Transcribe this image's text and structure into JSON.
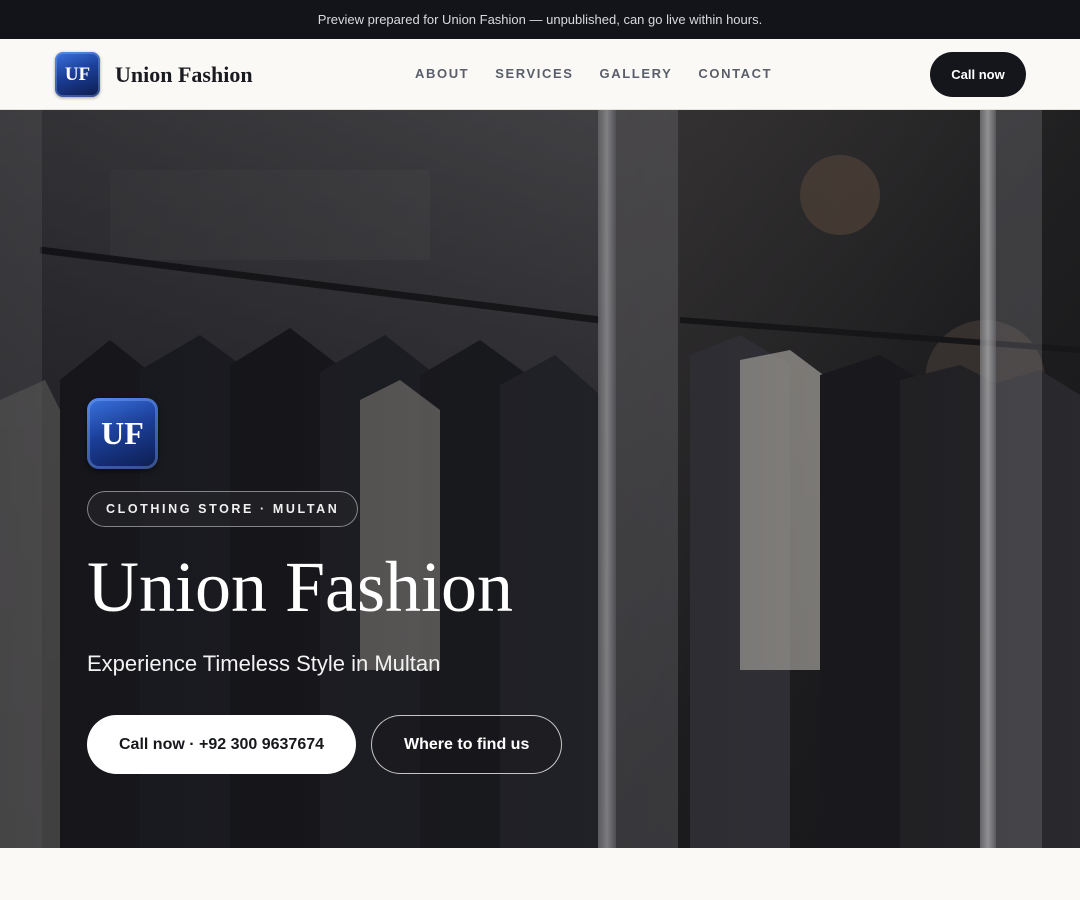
{
  "announcement": {
    "text": "Preview prepared for Union Fashion — unpublished, can go live within hours."
  },
  "header": {
    "logo_initials": "UF",
    "brand_name": "Union Fashion",
    "nav": [
      {
        "label": "ABOUT"
      },
      {
        "label": "SERVICES"
      },
      {
        "label": "GALLERY"
      },
      {
        "label": "CONTACT"
      }
    ],
    "cta_label": "Call now"
  },
  "hero": {
    "background": "clothing-store-window-photo",
    "logo_initials": "UF",
    "tagline": "CLOTHING STORE · MULTAN",
    "title": "Union Fashion",
    "subtitle": "Experience Timeless Style in Multan",
    "primary_button": "Call now · +92 300 9637674",
    "secondary_button": "Where to find us"
  },
  "colors": {
    "topbar_bg": "#121419",
    "header_bg": "#faf9f6",
    "dark_button": "#14161c",
    "logo_blue": "#1c3f9a"
  }
}
